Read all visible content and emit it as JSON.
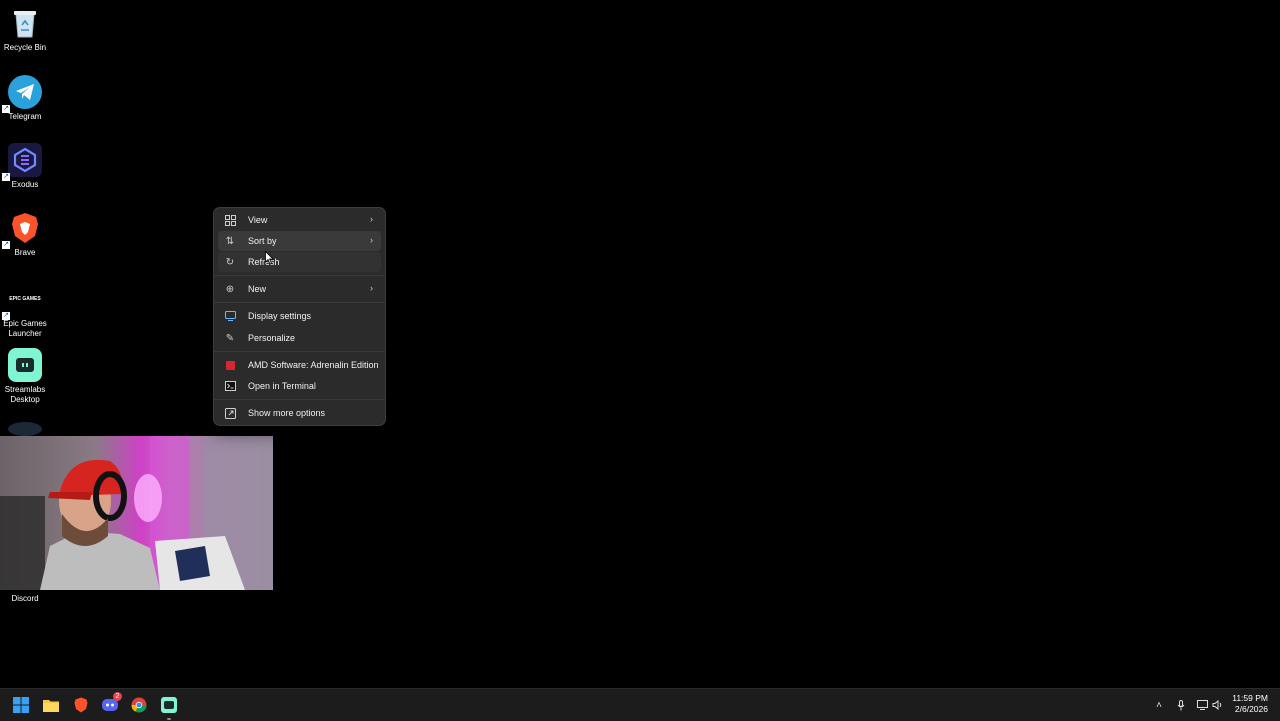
{
  "desktop": {
    "icons": [
      {
        "label": "Recycle Bin"
      },
      {
        "label": "Telegram"
      },
      {
        "label": "Exodus"
      },
      {
        "label": "Brave"
      },
      {
        "label": "Epic Games Launcher"
      },
      {
        "label": "Streamlabs Desktop"
      },
      {
        "label": "Discord"
      }
    ],
    "epic_logo_text": "EPIC GAMES"
  },
  "context_menu": {
    "items": [
      {
        "label": "View",
        "icon": "grid-icon",
        "submenu": true
      },
      {
        "label": "Sort by",
        "icon": "sort-icon",
        "submenu": true
      },
      {
        "label": "Refresh",
        "icon": "refresh-icon",
        "submenu": false
      },
      {
        "label": "New",
        "icon": "plus-circle-icon",
        "submenu": true
      },
      {
        "label": "Display settings",
        "icon": "display-icon",
        "submenu": false
      },
      {
        "label": "Personalize",
        "icon": "pen-icon",
        "submenu": false
      },
      {
        "label": "AMD Software: Adrenalin Edition",
        "icon": "amd-icon",
        "submenu": false
      },
      {
        "label": "Open in Terminal",
        "icon": "terminal-icon",
        "submenu": false
      },
      {
        "label": "Show more options",
        "icon": "share-icon",
        "submenu": false
      }
    ]
  },
  "taskbar": {
    "apps": [
      "start-icon",
      "file-explorer-icon",
      "brave-icon",
      "discord-icon",
      "chrome-icon",
      "streamlabs-icon"
    ],
    "discord_badge": "2",
    "clock": {
      "time": "11:59 PM",
      "date": "2/6/2026"
    }
  },
  "colors": {
    "menu_bg": "#2b2b2b",
    "menu_hover": "#3a3a3a",
    "taskbar_bg": "#1c1c1c",
    "accent": "#0067c0"
  }
}
